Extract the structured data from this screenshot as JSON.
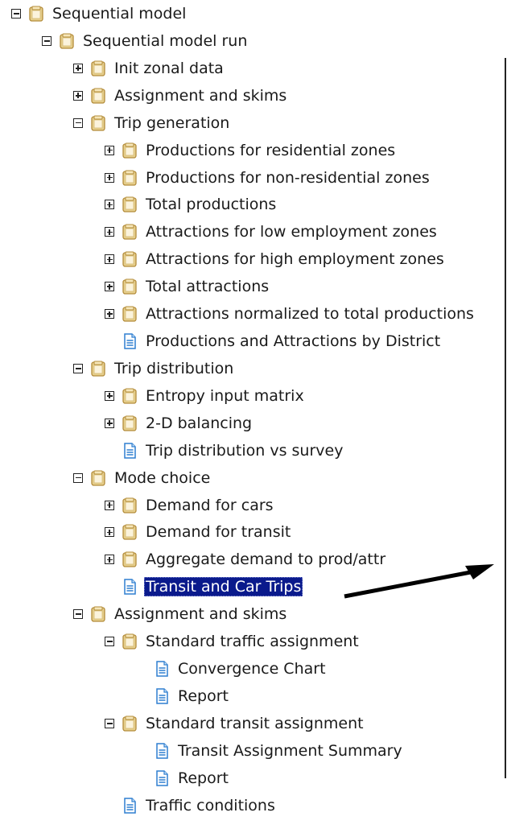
{
  "tree": {
    "nodes": [
      {
        "label": "Sequential model",
        "icon": "folder-icon",
        "expander": "minus",
        "level": 0
      },
      {
        "label": "Sequential model run",
        "icon": "folder-icon",
        "expander": "minus",
        "level": 1
      },
      {
        "label": "Init zonal data",
        "icon": "folder-icon",
        "expander": "plus",
        "level": 2
      },
      {
        "label": "Assignment and skims",
        "icon": "folder-icon",
        "expander": "plus",
        "level": 2
      },
      {
        "label": "Trip generation",
        "icon": "folder-icon",
        "expander": "minus",
        "level": 2
      },
      {
        "label": "Productions for residential zones",
        "icon": "folder-icon",
        "expander": "plus",
        "level": 3
      },
      {
        "label": "Productions for non-residential zones",
        "icon": "folder-icon",
        "expander": "plus",
        "level": 3
      },
      {
        "label": "Total productions",
        "icon": "folder-icon",
        "expander": "plus",
        "level": 3
      },
      {
        "label": "Attractions for low employment zones",
        "icon": "folder-icon",
        "expander": "plus",
        "level": 3
      },
      {
        "label": "Attractions for high employment zones",
        "icon": "folder-icon",
        "expander": "plus",
        "level": 3
      },
      {
        "label": "Total attractions",
        "icon": "folder-icon",
        "expander": "plus",
        "level": 3
      },
      {
        "label": "Attractions normalized to total productions",
        "icon": "folder-icon",
        "expander": "plus",
        "level": 3
      },
      {
        "label": "Productions and Attractions by District",
        "icon": "document-icon",
        "expander": "none",
        "level": 3
      },
      {
        "label": "Trip distribution",
        "icon": "folder-icon",
        "expander": "minus",
        "level": 2
      },
      {
        "label": "Entropy input matrix",
        "icon": "folder-icon",
        "expander": "plus",
        "level": 3
      },
      {
        "label": "2-D balancing",
        "icon": "folder-icon",
        "expander": "plus",
        "level": 3
      },
      {
        "label": "Trip distribution vs survey",
        "icon": "document-icon",
        "expander": "none",
        "level": 3
      },
      {
        "label": "Mode choice",
        "icon": "folder-icon",
        "expander": "minus",
        "level": 2
      },
      {
        "label": "Demand for cars",
        "icon": "folder-icon",
        "expander": "plus",
        "level": 3
      },
      {
        "label": "Demand for transit",
        "icon": "folder-icon",
        "expander": "plus",
        "level": 3
      },
      {
        "label": "Aggregate demand to prod/attr",
        "icon": "folder-icon",
        "expander": "plus",
        "level": 3
      },
      {
        "label": "Transit and Car Trips",
        "icon": "document-icon",
        "expander": "none",
        "level": 3,
        "selected": true
      },
      {
        "label": "Assignment and skims",
        "icon": "folder-icon",
        "expander": "minus",
        "level": 2
      },
      {
        "label": "Standard traffic assignment",
        "icon": "folder-icon",
        "expander": "minus",
        "level": 3
      },
      {
        "label": "Convergence Chart",
        "icon": "document-icon",
        "expander": "none",
        "level": 4
      },
      {
        "label": "Report",
        "icon": "document-icon",
        "expander": "none",
        "level": 4
      },
      {
        "label": "Standard transit assignment",
        "icon": "folder-icon",
        "expander": "minus",
        "level": 3
      },
      {
        "label": "Transit Assignment Summary",
        "icon": "document-icon",
        "expander": "none",
        "level": 4
      },
      {
        "label": "Report",
        "icon": "document-icon",
        "expander": "none",
        "level": 4
      },
      {
        "label": "Traffic conditions",
        "icon": "document-icon",
        "expander": "none",
        "level": 3
      }
    ]
  },
  "colors": {
    "selection_bg": "#0a1a8c",
    "folder_tan": "#c8a85a",
    "document_blue": "#2f7fd0",
    "arrow": "#000000"
  }
}
